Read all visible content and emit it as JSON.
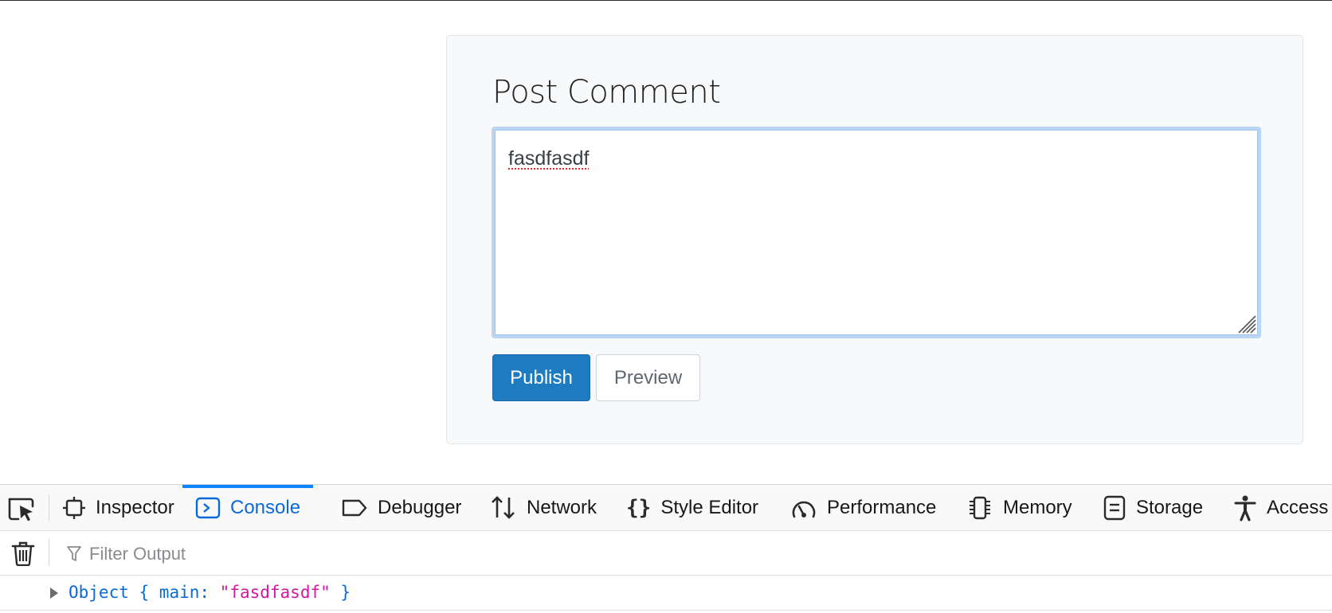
{
  "comment": {
    "title": "Post Comment",
    "textarea_value": "fasdfasdf",
    "publish_label": "Publish",
    "preview_label": "Preview"
  },
  "devtools": {
    "tabs": [
      {
        "label": "Inspector",
        "icon": "inspector-icon"
      },
      {
        "label": "Console",
        "icon": "console-icon",
        "selected": true
      },
      {
        "label": "Debugger",
        "icon": "debugger-icon"
      },
      {
        "label": "Network",
        "icon": "network-icon"
      },
      {
        "label": "Style Editor",
        "icon": "style-editor-icon"
      },
      {
        "label": "Performance",
        "icon": "performance-icon"
      },
      {
        "label": "Memory",
        "icon": "memory-icon"
      },
      {
        "label": "Storage",
        "icon": "storage-icon"
      },
      {
        "label": "Access",
        "icon": "accessibility-icon"
      }
    ],
    "filter_placeholder": "Filter Output",
    "console_log": {
      "prefix": "Object { ",
      "key": "main",
      "separator": ": ",
      "value": "\"fasdfasdf\"",
      "suffix": " }"
    }
  },
  "colors": {
    "accent": "#0a84ff",
    "publish_button": "#1f7bbf",
    "console_string": "#d3179f"
  }
}
